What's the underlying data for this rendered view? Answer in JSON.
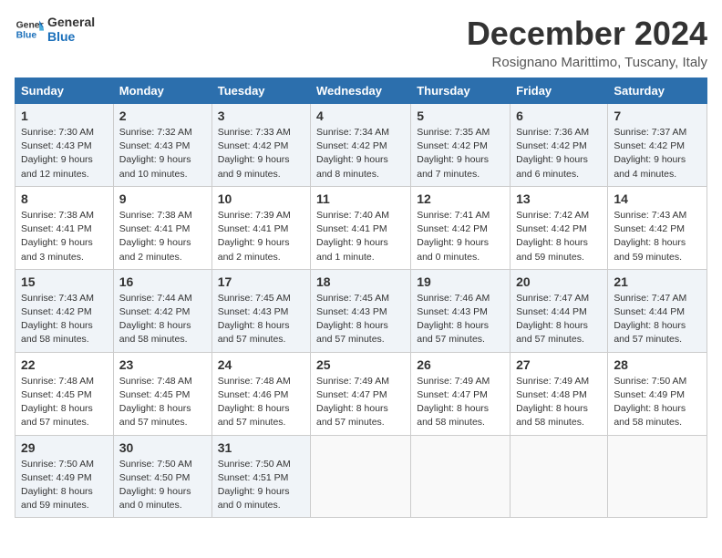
{
  "logo": {
    "line1": "General",
    "line2": "Blue"
  },
  "title": "December 2024",
  "location": "Rosignano Marittimo, Tuscany, Italy",
  "weekdays": [
    "Sunday",
    "Monday",
    "Tuesday",
    "Wednesday",
    "Thursday",
    "Friday",
    "Saturday"
  ],
  "weeks": [
    [
      {
        "day": "1",
        "sunrise": "7:30 AM",
        "sunset": "4:43 PM",
        "daylight": "9 hours and 12 minutes."
      },
      {
        "day": "2",
        "sunrise": "7:32 AM",
        "sunset": "4:43 PM",
        "daylight": "9 hours and 10 minutes."
      },
      {
        "day": "3",
        "sunrise": "7:33 AM",
        "sunset": "4:42 PM",
        "daylight": "9 hours and 9 minutes."
      },
      {
        "day": "4",
        "sunrise": "7:34 AM",
        "sunset": "4:42 PM",
        "daylight": "9 hours and 8 minutes."
      },
      {
        "day": "5",
        "sunrise": "7:35 AM",
        "sunset": "4:42 PM",
        "daylight": "9 hours and 7 minutes."
      },
      {
        "day": "6",
        "sunrise": "7:36 AM",
        "sunset": "4:42 PM",
        "daylight": "9 hours and 6 minutes."
      },
      {
        "day": "7",
        "sunrise": "7:37 AM",
        "sunset": "4:42 PM",
        "daylight": "9 hours and 4 minutes."
      }
    ],
    [
      {
        "day": "8",
        "sunrise": "7:38 AM",
        "sunset": "4:41 PM",
        "daylight": "9 hours and 3 minutes."
      },
      {
        "day": "9",
        "sunrise": "7:38 AM",
        "sunset": "4:41 PM",
        "daylight": "9 hours and 2 minutes."
      },
      {
        "day": "10",
        "sunrise": "7:39 AM",
        "sunset": "4:41 PM",
        "daylight": "9 hours and 2 minutes."
      },
      {
        "day": "11",
        "sunrise": "7:40 AM",
        "sunset": "4:41 PM",
        "daylight": "9 hours and 1 minute."
      },
      {
        "day": "12",
        "sunrise": "7:41 AM",
        "sunset": "4:42 PM",
        "daylight": "9 hours and 0 minutes."
      },
      {
        "day": "13",
        "sunrise": "7:42 AM",
        "sunset": "4:42 PM",
        "daylight": "8 hours and 59 minutes."
      },
      {
        "day": "14",
        "sunrise": "7:43 AM",
        "sunset": "4:42 PM",
        "daylight": "8 hours and 59 minutes."
      }
    ],
    [
      {
        "day": "15",
        "sunrise": "7:43 AM",
        "sunset": "4:42 PM",
        "daylight": "8 hours and 58 minutes."
      },
      {
        "day": "16",
        "sunrise": "7:44 AM",
        "sunset": "4:42 PM",
        "daylight": "8 hours and 58 minutes."
      },
      {
        "day": "17",
        "sunrise": "7:45 AM",
        "sunset": "4:43 PM",
        "daylight": "8 hours and 57 minutes."
      },
      {
        "day": "18",
        "sunrise": "7:45 AM",
        "sunset": "4:43 PM",
        "daylight": "8 hours and 57 minutes."
      },
      {
        "day": "19",
        "sunrise": "7:46 AM",
        "sunset": "4:43 PM",
        "daylight": "8 hours and 57 minutes."
      },
      {
        "day": "20",
        "sunrise": "7:47 AM",
        "sunset": "4:44 PM",
        "daylight": "8 hours and 57 minutes."
      },
      {
        "day": "21",
        "sunrise": "7:47 AM",
        "sunset": "4:44 PM",
        "daylight": "8 hours and 57 minutes."
      }
    ],
    [
      {
        "day": "22",
        "sunrise": "7:48 AM",
        "sunset": "4:45 PM",
        "daylight": "8 hours and 57 minutes."
      },
      {
        "day": "23",
        "sunrise": "7:48 AM",
        "sunset": "4:45 PM",
        "daylight": "8 hours and 57 minutes."
      },
      {
        "day": "24",
        "sunrise": "7:48 AM",
        "sunset": "4:46 PM",
        "daylight": "8 hours and 57 minutes."
      },
      {
        "day": "25",
        "sunrise": "7:49 AM",
        "sunset": "4:47 PM",
        "daylight": "8 hours and 57 minutes."
      },
      {
        "day": "26",
        "sunrise": "7:49 AM",
        "sunset": "4:47 PM",
        "daylight": "8 hours and 58 minutes."
      },
      {
        "day": "27",
        "sunrise": "7:49 AM",
        "sunset": "4:48 PM",
        "daylight": "8 hours and 58 minutes."
      },
      {
        "day": "28",
        "sunrise": "7:50 AM",
        "sunset": "4:49 PM",
        "daylight": "8 hours and 58 minutes."
      }
    ],
    [
      {
        "day": "29",
        "sunrise": "7:50 AM",
        "sunset": "4:49 PM",
        "daylight": "8 hours and 59 minutes."
      },
      {
        "day": "30",
        "sunrise": "7:50 AM",
        "sunset": "4:50 PM",
        "daylight": "9 hours and 0 minutes."
      },
      {
        "day": "31",
        "sunrise": "7:50 AM",
        "sunset": "4:51 PM",
        "daylight": "9 hours and 0 minutes."
      },
      null,
      null,
      null,
      null
    ]
  ]
}
